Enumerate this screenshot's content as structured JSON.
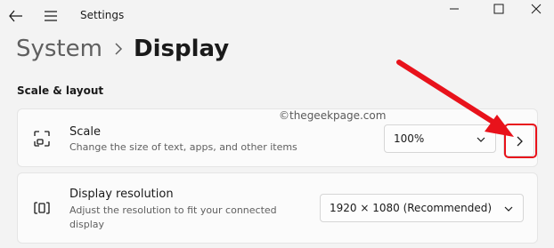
{
  "window": {
    "title": "Settings"
  },
  "breadcrumb": {
    "parent": "System",
    "current": "Display"
  },
  "section": {
    "title": "Scale & layout"
  },
  "scale": {
    "title": "Scale",
    "description": "Change the size of text, apps, and other items",
    "selected": "100%"
  },
  "resolution": {
    "title": "Display resolution",
    "description": "Adjust the resolution to fit your connected display",
    "selected": "1920 × 1080 (Recommended)"
  },
  "watermark": "©thegeekpage.com",
  "icons": {
    "back": "back-arrow-icon",
    "menu": "hamburger-menu-icon",
    "minimize": "minimize-icon",
    "maximize": "maximize-icon",
    "close": "close-icon",
    "scale": "scale-icon",
    "resolution": "resolution-icon",
    "chevron_down": "chevron-down-icon",
    "chevron_right": "chevron-right-icon"
  },
  "colors": {
    "annotation": "#e8121b",
    "background": "#f3f3f3",
    "card": "#fbfbfb"
  }
}
